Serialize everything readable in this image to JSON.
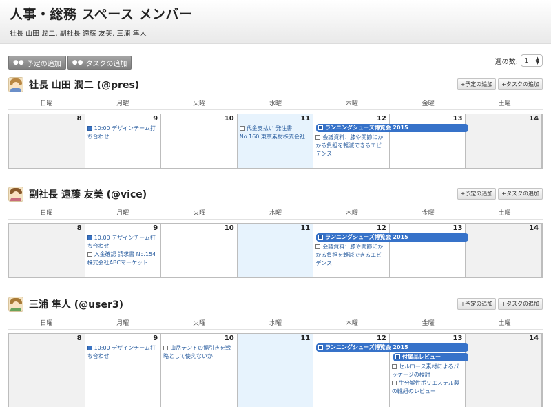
{
  "header": {
    "title": "人事・総務 スペース メンバー",
    "members": "社長 山田 潤二, 副社長 遠藤 友美, 三浦 隼人"
  },
  "toolbar": {
    "add_schedule": "予定の追加",
    "add_task": "タスクの追加",
    "weeks_label": "週の数:",
    "weeks_value": "1"
  },
  "weekdays": [
    "日曜",
    "月曜",
    "火曜",
    "水曜",
    "木曜",
    "金曜",
    "土曜"
  ],
  "days": [
    "8",
    "9",
    "10",
    "11",
    "12",
    "13",
    "14"
  ],
  "small_buttons": {
    "add_schedule": "+予定の追加",
    "add_task": "+タスクの追加"
  },
  "users": [
    {
      "name": "社長 山田 潤二 (@pres)",
      "mon_event": "10:00 デザインチーム打ち合わせ",
      "wed_task": "代金支払い 発注書 No.160 東京素材株式会社",
      "thu_bar": "ランニングシューズ博覧会 2015",
      "thu_task": "会議資料：膝や関節にかかる負担を軽減できるエビデンス"
    },
    {
      "name": "副社長 遠藤 友美 (@vice)",
      "mon_event": "10:00 デザインチーム打ち合わせ",
      "mon_task": "入金確認 請求書 No.154 株式会社ABCマーケット",
      "thu_bar": "ランニングシューズ博覧会 2015",
      "thu_task": "会議資料：膝や関節にかかる負担を軽減できるエビデンス"
    },
    {
      "name": "三浦 隼人 (@user3)",
      "mon_event": "10:00 デザインチーム打ち合わせ",
      "tue_task": "山岳テントの据引きを戦略として使えないか",
      "thu_bar": "ランニングシューズ博覧会 2015",
      "fri_bar": "付属品レビュー",
      "fri_task1": "セルロース素材によるパッケージの検討",
      "fri_task2": "生分解性ポリエステル製の靴紐のレビュー"
    }
  ],
  "colors": {
    "event_bar": "#3672c9",
    "today_bg": "#e7f3fd",
    "weekend_bg": "#f1f1f1"
  }
}
